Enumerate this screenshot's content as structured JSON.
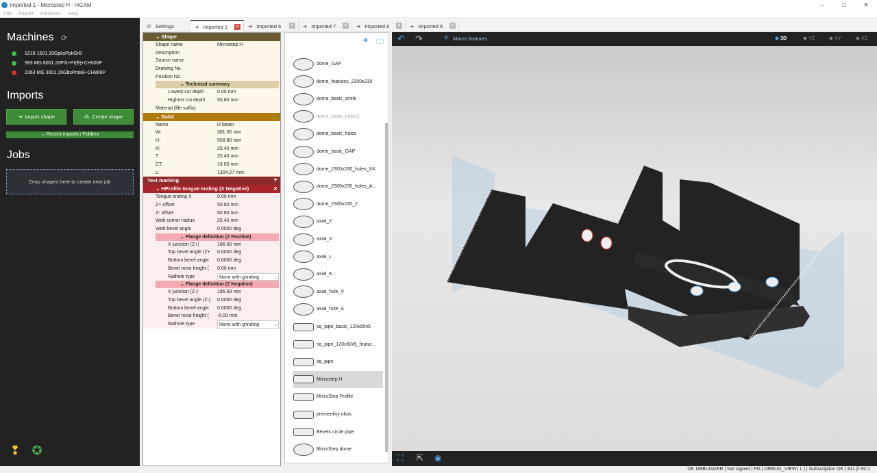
{
  "window": {
    "title": "Imported 1 - Microstep H - mCAM",
    "controls": [
      "–",
      "□",
      "✕"
    ]
  },
  "menu": [
    "File",
    "Import",
    "Windows",
    "Help"
  ],
  "sidebar": {
    "machines_title": "Machines",
    "machines": [
      {
        "label": "1216 1501.15GpksPpkGrB",
        "color": "#35c43a"
      },
      {
        "label": "993 MG 6001.20Prk+PI(B)+CH500P",
        "color": "#35c43a"
      },
      {
        "label": "2263 MG  3001.15GbsPrskB+CH800P",
        "color": "#e03020"
      }
    ],
    "imports_title": "Imports",
    "import_shape": "Import shape",
    "create_shape": "Create shape",
    "recent": "Recent imports / Folders",
    "jobs_title": "Jobs",
    "drop_text": "Drop shapes here to create new job"
  },
  "tabs": [
    "Settings",
    "Imported 1",
    "Imported 6",
    "Imported 7",
    "Imported 8",
    "Imported 9"
  ],
  "shape_section": {
    "title": "Shape",
    "rows": [
      [
        "Shape name",
        "Microstep H"
      ],
      [
        "Description",
        ""
      ],
      [
        "Source name",
        ""
      ],
      [
        "Drawing No.",
        ""
      ],
      [
        "Position No.",
        ""
      ]
    ],
    "tech_title": "Technical summary",
    "tech_rows": [
      [
        "Lowest cut depth",
        "0.00 mm"
      ],
      [
        "Highest cut depth",
        "50.80 mm"
      ]
    ],
    "material": "Material (file suffix)"
  },
  "solid_section": {
    "title": "Solid",
    "rows": [
      [
        "Name",
        "H beam"
      ],
      [
        "W:",
        "381.00 mm"
      ],
      [
        "H:",
        "558.80 mm"
      ],
      [
        "R:",
        "25.40 mm"
      ],
      [
        "T",
        "25.40 mm"
      ],
      [
        "CT:",
        "19.05 mm"
      ],
      [
        "L:",
        "1304.07 mm"
      ]
    ]
  },
  "text_marking": {
    "title": "Text marking",
    "plus": "+"
  },
  "hprofile": {
    "title": "HProfile tongue ending (X Negative)",
    "close": "✕",
    "rows": [
      [
        "Tongue ending X",
        "0.00 mm"
      ],
      [
        "Z+ offset",
        "50.80 mm"
      ],
      [
        "Z- offset",
        "50.80 mm"
      ],
      [
        "Web corner radius",
        "25.40 mm"
      ],
      [
        "Web bevel angle",
        "0.0000 deg"
      ]
    ],
    "flange_pos_title": "Flange definition (Z Positive)",
    "flange_pos": [
      [
        "X junction (Z+)",
        "186.69 mm"
      ],
      [
        "Top bevel angle (Z+",
        "0.0000 deg"
      ],
      [
        "Bottom bevel angle",
        "0.0000 deg"
      ],
      [
        "Bevel nose height (",
        "0.00 mm"
      ],
      [
        "Rathole type",
        "None with grinding"
      ]
    ],
    "flange_neg_title": "Flange definition (Z Negative)",
    "flange_neg": [
      [
        "X junction (Z-)",
        "186.69 mm"
      ],
      [
        "Top bevel angle (Z-)",
        "0.0000 deg"
      ],
      [
        "Bottom bevel angle",
        "0.0000 deg"
      ],
      [
        "Bevel nose height (",
        "-0.00 mm"
      ],
      [
        "Rathole type",
        "None with grinding"
      ]
    ]
  },
  "shapes_list": [
    "dome_GAP",
    "dome_features_2300x230",
    "dome_basic_smile",
    "dome_basic_holes2",
    "dome_basic_holes",
    "dome_basic_GAP",
    "dome_2300x230_holes_XK",
    "dome_2300x230_holes_A...",
    "dome_2300x230_2",
    "axial_Y",
    "axial_X",
    "axial_L",
    "axial_K",
    "axial_hole_V",
    "axial_hole_A",
    "sq_pipe_basic_120x60x5",
    "sq_pipe_120x60x5_featur...",
    "sq_pipe",
    "Microstep H",
    "MicroStep Profile",
    "premenlivy ukos",
    "Bevels circle pipe",
    "MicroStep dome"
  ],
  "viewport": {
    "macro": "Macro features",
    "views": [
      "3D",
      "YZ",
      "XY",
      "XZ"
    ]
  },
  "statusbar": "OK      DEBUGGER | Not signed | FG | DEBUG_VIEW( 1 ) | Subscription OK | 811.β RC1"
}
